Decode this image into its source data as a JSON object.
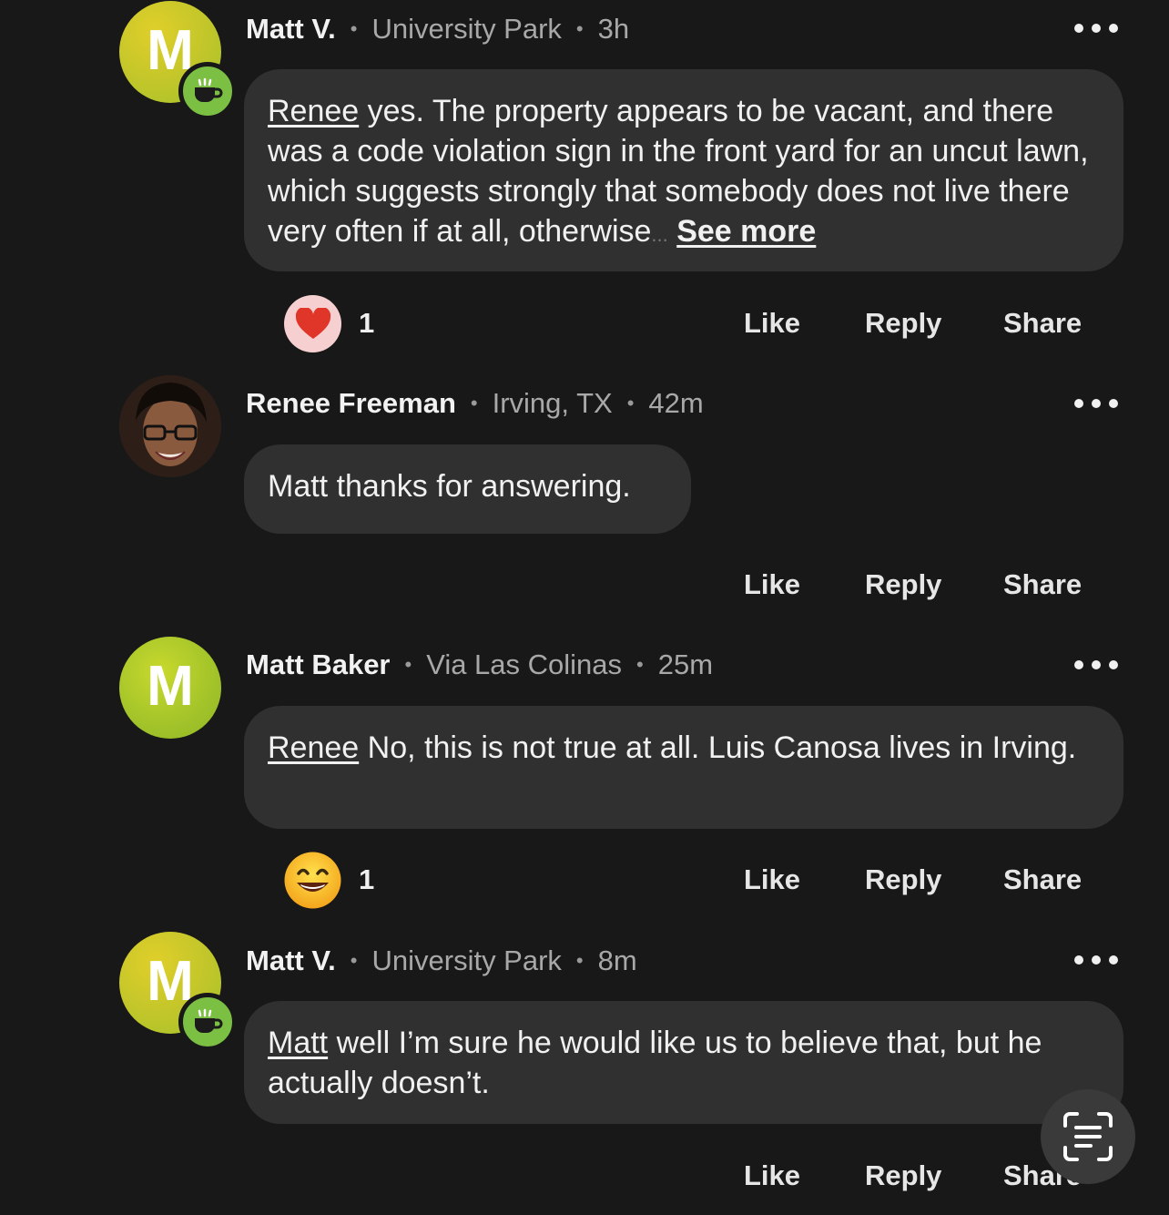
{
  "comments": [
    {
      "name": "Matt V.",
      "location": "University Park",
      "time": "3h",
      "avatar_letter": "M",
      "mention": "Renee",
      "text": " yes. The property appears to be vacant, and there was a code violation sign in the front yard for an uncut lawn, which suggests strongly that somebody does not live there very often if at all, otherwise",
      "ellipsis": "...",
      "see_more": "See more",
      "reaction_icon": "heart-icon",
      "reaction_count": "1"
    },
    {
      "name": "Renee Freeman",
      "location": "Irving, TX",
      "time": "42m",
      "text": "Matt thanks for answering."
    },
    {
      "name": "Matt Baker",
      "location": "Via Las Colinas",
      "time": "25m",
      "avatar_letter": "M",
      "mention": "Renee",
      "text": " No, this is not true at all.  Luis Canosa lives in Irving.",
      "reaction_icon": "grinning-face-icon",
      "reaction_count": "1"
    },
    {
      "name": "Matt V.",
      "location": "University Park",
      "time": "8m",
      "avatar_letter": "M",
      "mention": "Matt",
      "text": " well I’m sure he would like us to believe that, but he actually doesn’t."
    }
  ],
  "actions": {
    "like": "Like",
    "reply": "Reply",
    "share": "Share"
  },
  "separator": "•",
  "colors": {
    "background": "#181818",
    "bubble": "#303030",
    "avatar_green": "#a5c52a",
    "badge_green": "#7bc043"
  }
}
